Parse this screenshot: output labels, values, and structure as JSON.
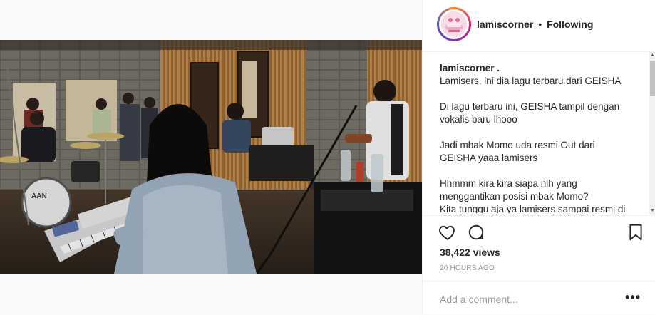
{
  "post": {
    "username": "lamiscorner",
    "separator": "•",
    "follow_label": "Following",
    "caption_user": "lamiscorner .",
    "caption_paragraphs": [
      "Lamisers, ini dia lagu terbaru dari GEISHA",
      "Di lagu terbaru ini, GEISHA tampil dengan\nvokalis baru lhooo",
      "Jadi mbak Momo uda resmi Out dari\nGEISHA yaaa lamisers",
      "Hhmmm kira kira siapa nih yang\nmenggantikan posisi mbak Momo?\nKita tunggu aja ya lamisers sampai resmi di"
    ],
    "views": "38,422 views",
    "time": "20 HOURS AGO",
    "comment_placeholder": "Add a comment...",
    "more_label": "•••"
  },
  "icons": {
    "like": "heart-icon",
    "comment": "comment-bubble-icon",
    "save": "bookmark-icon",
    "more": "more-options-icon",
    "scroll_up": "scroll-up-arrow-icon",
    "scroll_down": "scroll-down-arrow-icon"
  },
  "colors": {
    "text": "#262626",
    "muted": "#999999",
    "border": "#efefef",
    "background": "#fafafa"
  },
  "scroll": {
    "up_glyph": "▲",
    "down_glyph": "▼"
  }
}
